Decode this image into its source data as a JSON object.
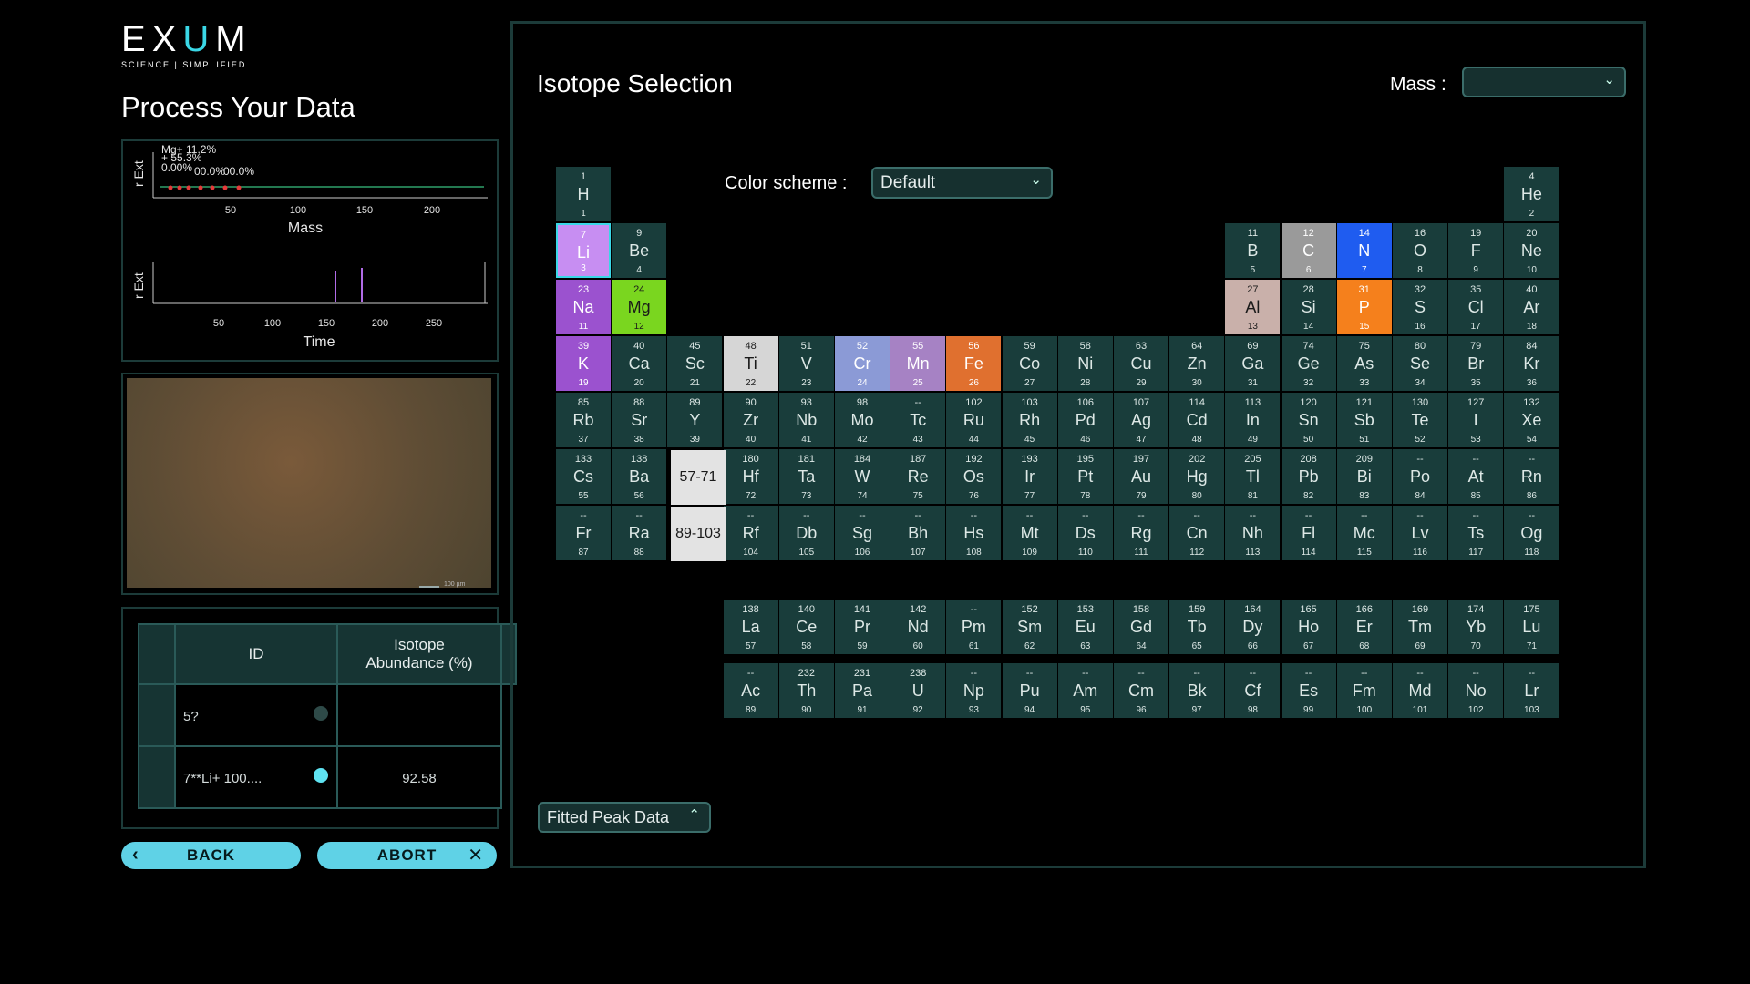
{
  "logo": {
    "brand": "EXUM",
    "tagline": "SCIENCE | SIMPLIFIED"
  },
  "page_title": "Process Your Data",
  "mass_chart": {
    "ylabel": "r Ext",
    "xlabel": "Mass",
    "ticks": [
      "50",
      "100",
      "150",
      "200"
    ],
    "legend": [
      "Mg+ 11.2%",
      "+ 55.3%",
      "0.00%",
      "00.0%",
      "00.0%"
    ]
  },
  "time_chart": {
    "ylabel": "r Ext",
    "xlabel": "Time",
    "ticks": [
      "50",
      "100",
      "150",
      "200",
      "250"
    ]
  },
  "image_panel": {
    "scale_text": "100 µm"
  },
  "table": {
    "headers": [
      "ID",
      "Isotope Abundance (%)"
    ],
    "rows": [
      {
        "id": "5?",
        "abundance": "",
        "dot_color": "#2e4a48"
      },
      {
        "id": "7**Li+ 100....",
        "abundance": "92.58",
        "dot_color": "#5fe3f2"
      }
    ]
  },
  "buttons": {
    "back": "BACK",
    "abort": "ABORT"
  },
  "isotope": {
    "title": "Isotope Selection",
    "mass_label": "Mass :",
    "mass_value": "",
    "color_scheme_label": "Color scheme :",
    "color_scheme_value": "Default",
    "fitted_peak_label": "Fitted Peak Data",
    "placeholders": [
      "57-71",
      "89-103"
    ],
    "elements": [
      [
        "1",
        "H",
        "1",
        1,
        1
      ],
      [
        "4",
        "He",
        "2",
        18,
        1
      ],
      [
        "7",
        "Li",
        "3",
        1,
        2
      ],
      [
        "9",
        "Be",
        "4",
        2,
        2
      ],
      [
        "11",
        "B",
        "5",
        13,
        2
      ],
      [
        "12",
        "C",
        "6",
        14,
        2
      ],
      [
        "14",
        "N",
        "7",
        15,
        2
      ],
      [
        "16",
        "O",
        "8",
        16,
        2
      ],
      [
        "19",
        "F",
        "9",
        17,
        2
      ],
      [
        "20",
        "Ne",
        "10",
        18,
        2
      ],
      [
        "23",
        "Na",
        "11",
        1,
        3
      ],
      [
        "24",
        "Mg",
        "12",
        2,
        3
      ],
      [
        "27",
        "Al",
        "13",
        13,
        3
      ],
      [
        "28",
        "Si",
        "14",
        14,
        3
      ],
      [
        "31",
        "P",
        "15",
        15,
        3
      ],
      [
        "32",
        "S",
        "16",
        16,
        3
      ],
      [
        "35",
        "Cl",
        "17",
        17,
        3
      ],
      [
        "40",
        "Ar",
        "18",
        18,
        3
      ],
      [
        "39",
        "K",
        "19",
        1,
        4
      ],
      [
        "40",
        "Ca",
        "20",
        2,
        4
      ],
      [
        "45",
        "Sc",
        "21",
        3,
        4
      ],
      [
        "48",
        "Ti",
        "22",
        4,
        4
      ],
      [
        "51",
        "V",
        "23",
        5,
        4
      ],
      [
        "52",
        "Cr",
        "24",
        6,
        4
      ],
      [
        "55",
        "Mn",
        "25",
        7,
        4
      ],
      [
        "56",
        "Fe",
        "26",
        8,
        4
      ],
      [
        "59",
        "Co",
        "27",
        9,
        4
      ],
      [
        "58",
        "Ni",
        "28",
        10,
        4
      ],
      [
        "63",
        "Cu",
        "29",
        11,
        4
      ],
      [
        "64",
        "Zn",
        "30",
        12,
        4
      ],
      [
        "69",
        "Ga",
        "31",
        13,
        4
      ],
      [
        "74",
        "Ge",
        "32",
        14,
        4
      ],
      [
        "75",
        "As",
        "33",
        15,
        4
      ],
      [
        "80",
        "Se",
        "34",
        16,
        4
      ],
      [
        "79",
        "Br",
        "35",
        17,
        4
      ],
      [
        "84",
        "Kr",
        "36",
        18,
        4
      ],
      [
        "85",
        "Rb",
        "37",
        1,
        5
      ],
      [
        "88",
        "Sr",
        "38",
        2,
        5
      ],
      [
        "89",
        "Y",
        "39",
        3,
        5
      ],
      [
        "90",
        "Zr",
        "40",
        4,
        5
      ],
      [
        "93",
        "Nb",
        "41",
        5,
        5
      ],
      [
        "98",
        "Mo",
        "42",
        6,
        5
      ],
      [
        "--",
        "Tc",
        "43",
        7,
        5
      ],
      [
        "102",
        "Ru",
        "44",
        8,
        5
      ],
      [
        "103",
        "Rh",
        "45",
        9,
        5
      ],
      [
        "106",
        "Pd",
        "46",
        10,
        5
      ],
      [
        "107",
        "Ag",
        "47",
        11,
        5
      ],
      [
        "114",
        "Cd",
        "48",
        12,
        5
      ],
      [
        "113",
        "In",
        "49",
        13,
        5
      ],
      [
        "120",
        "Sn",
        "50",
        14,
        5
      ],
      [
        "121",
        "Sb",
        "51",
        15,
        5
      ],
      [
        "130",
        "Te",
        "52",
        16,
        5
      ],
      [
        "127",
        "I",
        "53",
        17,
        5
      ],
      [
        "132",
        "Xe",
        "54",
        18,
        5
      ],
      [
        "133",
        "Cs",
        "55",
        1,
        6
      ],
      [
        "138",
        "Ba",
        "56",
        2,
        6
      ],
      [
        "180",
        "Hf",
        "72",
        4,
        6
      ],
      [
        "181",
        "Ta",
        "73",
        5,
        6
      ],
      [
        "184",
        "W",
        "74",
        6,
        6
      ],
      [
        "187",
        "Re",
        "75",
        7,
        6
      ],
      [
        "192",
        "Os",
        "76",
        8,
        6
      ],
      [
        "193",
        "Ir",
        "77",
        9,
        6
      ],
      [
        "195",
        "Pt",
        "78",
        10,
        6
      ],
      [
        "197",
        "Au",
        "79",
        11,
        6
      ],
      [
        "202",
        "Hg",
        "80",
        12,
        6
      ],
      [
        "205",
        "Tl",
        "81",
        13,
        6
      ],
      [
        "208",
        "Pb",
        "82",
        14,
        6
      ],
      [
        "209",
        "Bi",
        "83",
        15,
        6
      ],
      [
        "--",
        "Po",
        "84",
        16,
        6
      ],
      [
        "--",
        "At",
        "85",
        17,
        6
      ],
      [
        "--",
        "Rn",
        "86",
        18,
        6
      ],
      [
        "--",
        "Fr",
        "87",
        1,
        7
      ],
      [
        "--",
        "Ra",
        "88",
        2,
        7
      ],
      [
        "--",
        "Rf",
        "104",
        4,
        7
      ],
      [
        "--",
        "Db",
        "105",
        5,
        7
      ],
      [
        "--",
        "Sg",
        "106",
        6,
        7
      ],
      [
        "--",
        "Bh",
        "107",
        7,
        7
      ],
      [
        "--",
        "Hs",
        "108",
        8,
        7
      ],
      [
        "--",
        "Mt",
        "109",
        9,
        7
      ],
      [
        "--",
        "Ds",
        "110",
        10,
        7
      ],
      [
        "--",
        "Rg",
        "111",
        11,
        7
      ],
      [
        "--",
        "Cn",
        "112",
        12,
        7
      ],
      [
        "--",
        "Nh",
        "113",
        13,
        7
      ],
      [
        "--",
        "Fl",
        "114",
        14,
        7
      ],
      [
        "--",
        "Mc",
        "115",
        15,
        7
      ],
      [
        "--",
        "Lv",
        "116",
        16,
        7
      ],
      [
        "--",
        "Ts",
        "117",
        17,
        7
      ],
      [
        "--",
        "Og",
        "118",
        18,
        7
      ],
      [
        "138",
        "La",
        "57",
        4,
        8
      ],
      [
        "140",
        "Ce",
        "58",
        5,
        8
      ],
      [
        "141",
        "Pr",
        "59",
        6,
        8
      ],
      [
        "142",
        "Nd",
        "60",
        7,
        8
      ],
      [
        "--",
        "Pm",
        "61",
        8,
        8
      ],
      [
        "152",
        "Sm",
        "62",
        9,
        8
      ],
      [
        "153",
        "Eu",
        "63",
        10,
        8
      ],
      [
        "158",
        "Gd",
        "64",
        11,
        8
      ],
      [
        "159",
        "Tb",
        "65",
        12,
        8
      ],
      [
        "164",
        "Dy",
        "66",
        13,
        8
      ],
      [
        "165",
        "Ho",
        "67",
        14,
        8
      ],
      [
        "166",
        "Er",
        "68",
        15,
        8
      ],
      [
        "169",
        "Tm",
        "69",
        16,
        8
      ],
      [
        "174",
        "Yb",
        "70",
        17,
        8
      ],
      [
        "175",
        "Lu",
        "71",
        18,
        8
      ],
      [
        "--",
        "Ac",
        "89",
        4,
        9
      ],
      [
        "232",
        "Th",
        "90",
        5,
        9
      ],
      [
        "231",
        "Pa",
        "91",
        6,
        9
      ],
      [
        "238",
        "U",
        "92",
        7,
        9
      ],
      [
        "--",
        "Np",
        "93",
        8,
        9
      ],
      [
        "--",
        "Pu",
        "94",
        9,
        9
      ],
      [
        "--",
        "Am",
        "95",
        10,
        9
      ],
      [
        "--",
        "Cm",
        "96",
        11,
        9
      ],
      [
        "--",
        "Bk",
        "97",
        12,
        9
      ],
      [
        "--",
        "Cf",
        "98",
        13,
        9
      ],
      [
        "--",
        "Es",
        "99",
        14,
        9
      ],
      [
        "--",
        "Fm",
        "100",
        15,
        9
      ],
      [
        "--",
        "Md",
        "101",
        16,
        9
      ],
      [
        "--",
        "No",
        "102",
        17,
        9
      ],
      [
        "--",
        "Lr",
        "103",
        18,
        9
      ]
    ],
    "highlight_colors": {
      "Li": "#c78ef2",
      "Na": "#9b52cf",
      "K": "#9b52cf",
      "Mg": "#7ad61f",
      "Ti": "#d6d6d6",
      "C": "#9a9a9a",
      "Al": "#c9b0aa",
      "N": "#1f5cf0",
      "P": "#f5801c",
      "Cr": "#8b9ad6",
      "Mn": "#a682c4",
      "Fe": "#e0702f"
    },
    "selected": "Li"
  }
}
